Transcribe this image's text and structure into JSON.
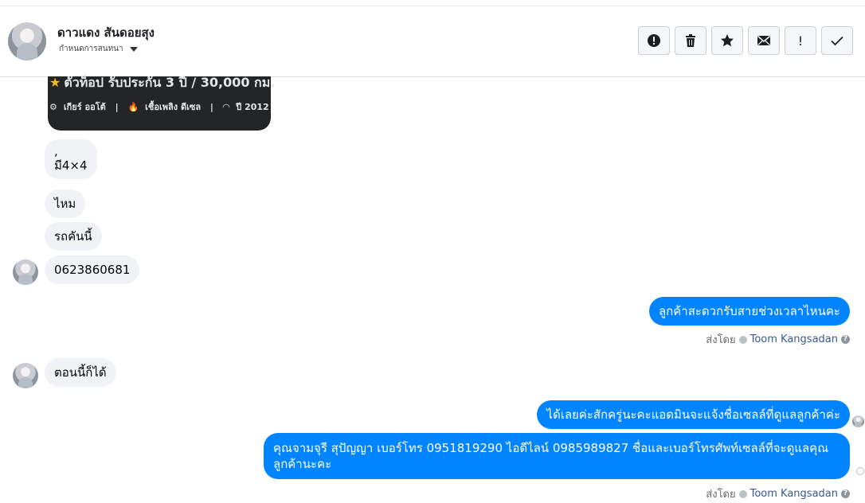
{
  "header": {
    "name": "ดาวแดง สันดอยสุง",
    "subtitle": "กำหนดการสนทนา",
    "actions": [
      {
        "icon": "exclamation-circle-icon",
        "label": ""
      },
      {
        "icon": "trash-icon",
        "label": ""
      },
      {
        "icon": "star-icon",
        "label": ""
      },
      {
        "icon": "envelope-icon",
        "label": ""
      },
      {
        "icon": "exclamation-icon",
        "label": "!"
      },
      {
        "icon": "check-icon",
        "label": ""
      }
    ]
  },
  "card": {
    "line1": "ตัวท็อป รับประกัน 3 ปี / 30,000 กม.",
    "gear": "เกียร์ ออโต้",
    "fuel": "เชื้อเพลิง ดีเซล",
    "year": "ปี 2012"
  },
  "messages": {
    "m1a": ",",
    "m1b": "มี4×4",
    "m2": "ไหม",
    "m3": "รถคันนี้",
    "m4": "0623860681",
    "m5": "ลูกค้าสะดวกรับสายช่วงเวลาไหนคะ",
    "m6": "ตอนนี้ก็ได้",
    "m7": "ได้เลยค่ะสักครู่นะคะแอดมินจะแจ้งชื่อเซลล์ที่ดูแลลูกค้าค่ะ",
    "m8a": "คุณจามจุรี สุปัญญา เบอร์โทร 0951819290  ไอดีไลน์ 0985989827 ชื่อและเบอร์โทรศัพท์เซลล์ที่จะดูแลคุณ",
    "m8b": "ลูกค้านะคะ"
  },
  "sent_by": {
    "prefix": "ส่งโดย",
    "agent": "Toom Kangsadan"
  }
}
